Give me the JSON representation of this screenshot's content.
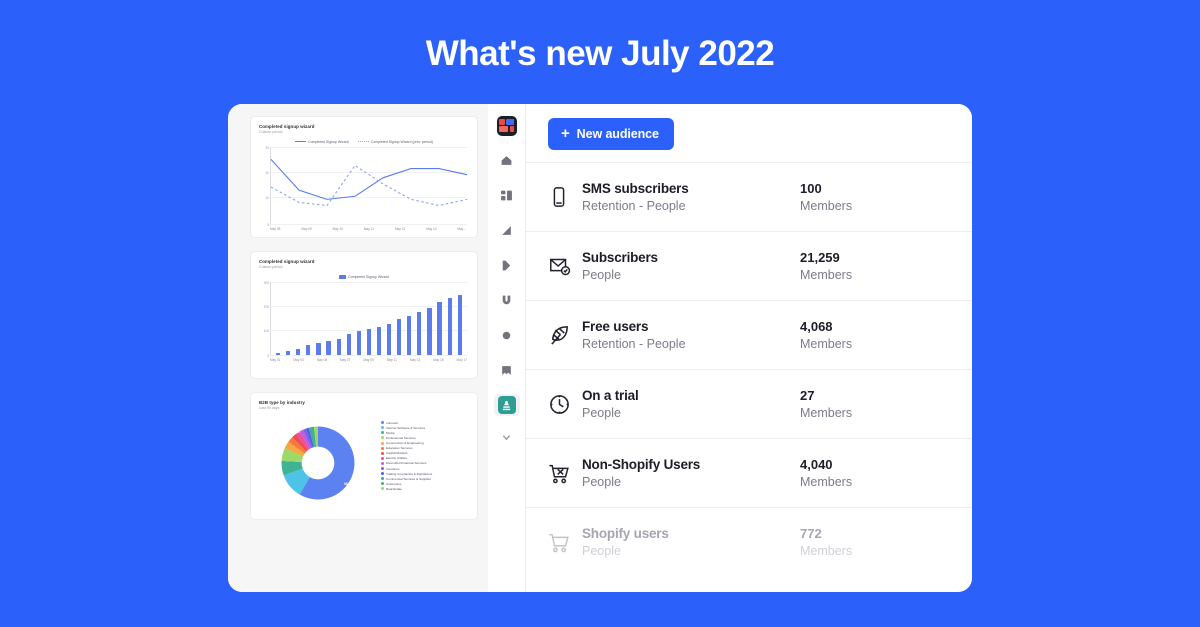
{
  "hero": {
    "title": "What's new July 2022",
    "background_color": "#2b60fb"
  },
  "rail": {
    "logo_name": "app-logo",
    "items": [
      {
        "icon": "home-icon",
        "label": "Home"
      },
      {
        "icon": "dashboard-icon",
        "label": "Dashboards"
      },
      {
        "icon": "analytics-icon",
        "label": "Analytics"
      },
      {
        "icon": "play-icon",
        "label": "Journeys"
      },
      {
        "icon": "magnet-icon",
        "label": "Campaigns"
      },
      {
        "icon": "circle-icon",
        "label": "Segments"
      },
      {
        "icon": "book-icon",
        "label": "Library"
      },
      {
        "icon": "audiences-icon",
        "label": "Audiences",
        "active": true
      },
      {
        "icon": "chevron-down-icon",
        "label": "More"
      }
    ],
    "active_color": "#2e9e92"
  },
  "toolbar": {
    "new_audience_label": "New audience",
    "plus_glyph": "+",
    "accent_color": "#2b60fb"
  },
  "audiences": [
    {
      "icon": "phone-icon",
      "name": "SMS subscribers",
      "meta": "Retention - People",
      "count": "100",
      "unit": "Members",
      "muted": false
    },
    {
      "icon": "envelope-check-icon",
      "name": "Subscribers",
      "meta": "People",
      "count": "21,259",
      "unit": "Members",
      "muted": false
    },
    {
      "icon": "leaf-icon",
      "name": "Free users",
      "meta": "Retention - People",
      "count": "4,068",
      "unit": "Members",
      "muted": false
    },
    {
      "icon": "clock-icon",
      "name": "On a trial",
      "meta": "People",
      "count": "27",
      "unit": "Members",
      "muted": false
    },
    {
      "icon": "cart-x-icon",
      "name": "Non-Shopify Users",
      "meta": "People",
      "count": "4,040",
      "unit": "Members",
      "muted": false
    },
    {
      "icon": "cart-icon",
      "name": "Shopify users",
      "meta": "People",
      "count": "772",
      "unit": "Members",
      "muted": true
    }
  ],
  "chart_data": [
    {
      "type": "line",
      "title": "Completed signup wizard",
      "subtitle": "Custom period",
      "xlabel": "",
      "ylabel": "",
      "ylim": [
        5,
        30
      ],
      "yticks": [
        "30",
        "20",
        "10",
        "5"
      ],
      "grid": true,
      "legend_position": "top",
      "categories": [
        "May 08",
        "May 09",
        "May 10",
        "May 11",
        "May 12",
        "May 13",
        "May ..."
      ],
      "series": [
        {
          "name": "Completed Signup Wizard",
          "style": "solid",
          "color": "#5b7cea",
          "values": [
            26,
            16,
            13,
            14,
            20,
            23,
            23,
            21
          ]
        },
        {
          "name": "Completed Signup Wizard (prev. period)",
          "style": "dotted",
          "color": "#8aa3f2",
          "values": [
            17,
            12,
            11,
            24,
            18,
            13,
            11,
            13
          ]
        }
      ]
    },
    {
      "type": "bar",
      "title": "Completed signup wizard",
      "subtitle": "Custom period",
      "xlabel": "",
      "ylabel": "",
      "ylim": [
        0,
        300
      ],
      "yticks": [
        "300",
        "200",
        "100",
        "0"
      ],
      "grid": true,
      "legend_position": "top",
      "categories": [
        "May 01",
        "May 03",
        "May 05",
        "May 07",
        "May 09",
        "May 11",
        "May 13",
        "May 15",
        "May 17"
      ],
      "series": [
        {
          "name": "Completed Signup Wizard",
          "color": "#5b7cea",
          "values": [
            8,
            14,
            22,
            38,
            50,
            55,
            66,
            85,
            97,
            106,
            114,
            128,
            148,
            160,
            175,
            193,
            218,
            233,
            247
          ]
        }
      ]
    },
    {
      "type": "pie",
      "title": "B2B type by industry",
      "subtitle": "Last 90 days",
      "legend_position": "right",
      "slices": [
        {
          "label": "unknown",
          "value": 58.4,
          "color": "#5b82f0",
          "shown_label": "58.4%"
        },
        {
          "label": "Internet Software & Services",
          "value": 11.1,
          "color": "#4ec3e8",
          "shown_label": "11.1%"
        },
        {
          "label": "Media",
          "value": 6.4,
          "color": "#3fb392",
          "shown_label": "6.4%"
        },
        {
          "label": "Professional Services",
          "value": 5.8,
          "color": "#9bd96a",
          "shown_label": "5.8%"
        },
        {
          "label": "Construction & Engineering",
          "value": 3.2,
          "color": "#f5a742",
          "shown_label": ""
        },
        {
          "label": "Education Services",
          "value": 2.6,
          "color": "#f5783c",
          "shown_label": ""
        },
        {
          "label": "Capital Markets",
          "value": 2.2,
          "color": "#ef4b55",
          "shown_label": ""
        },
        {
          "label": "Electric Utilities",
          "value": 1.9,
          "color": "#ec4fa0",
          "shown_label": ""
        },
        {
          "label": "Diversified Financial Services",
          "value": 1.6,
          "color": "#c05ce0",
          "shown_label": ""
        },
        {
          "label": "Insurance",
          "value": 1.4,
          "color": "#8a5ce0",
          "shown_label": ""
        },
        {
          "label": "Trading Companies & Distributors",
          "value": 1.3,
          "color": "#4660e8",
          "shown_label": ""
        },
        {
          "label": "Commercial Services & Supplies",
          "value": 1.2,
          "color": "#3fa3b5",
          "shown_label": ""
        },
        {
          "label": "Automotive",
          "value": 1.1,
          "color": "#3fb36a",
          "shown_label": ""
        },
        {
          "label": "Real Estate",
          "value": 1.8,
          "color": "#9bd96a",
          "shown_label": ""
        }
      ]
    }
  ]
}
